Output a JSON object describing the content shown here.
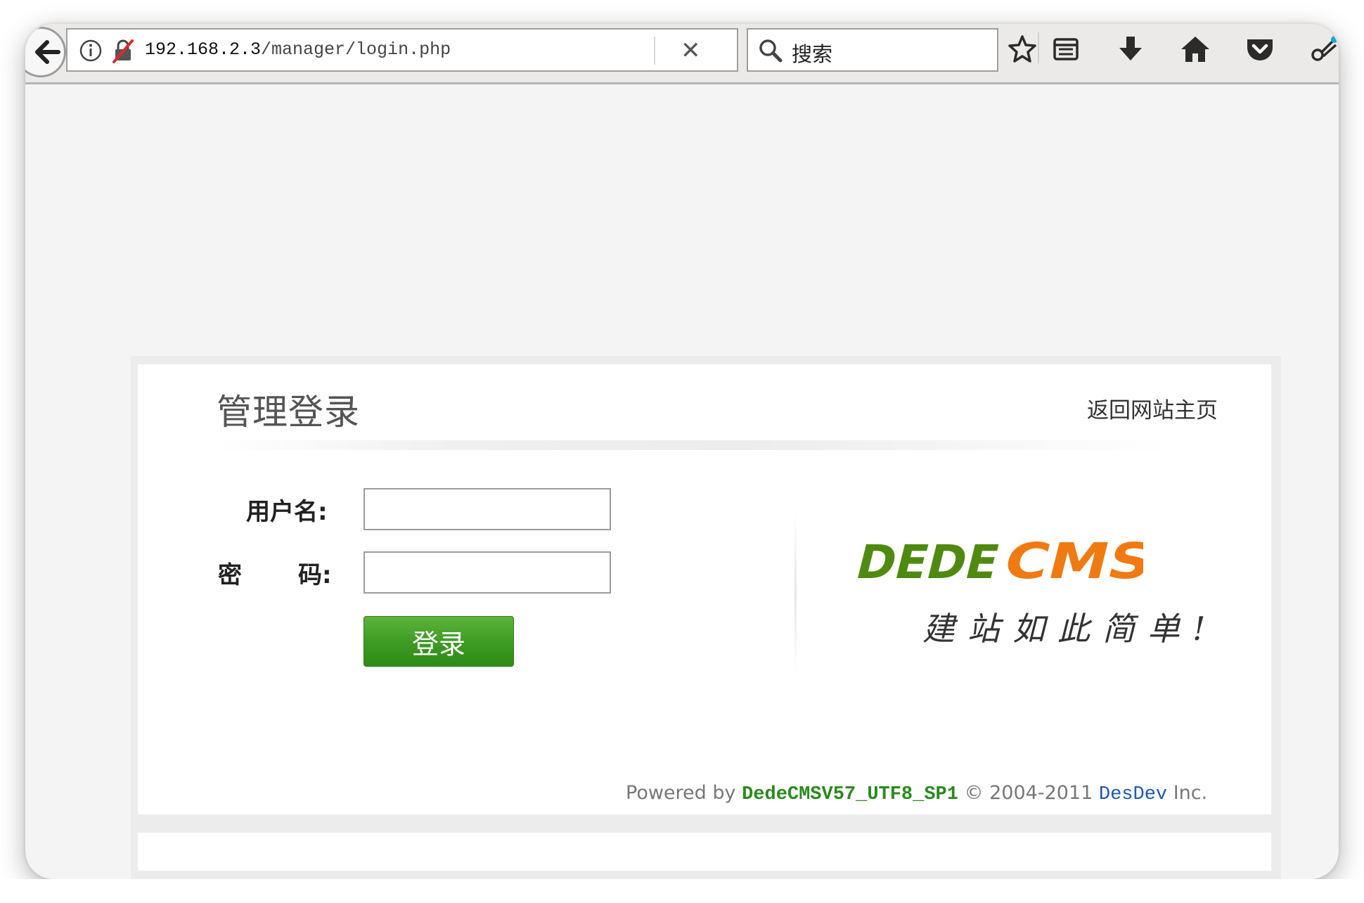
{
  "browser": {
    "url_host": "192.168.2.3",
    "url_path": "/manager/login.php",
    "search_placeholder": "搜索",
    "icons": [
      "back-arrow-icon",
      "info-icon",
      "insecure-lock-icon",
      "clear-url-icon",
      "search-icon",
      "bookmark-star-icon",
      "reading-list-icon",
      "download-icon",
      "home-icon",
      "pocket-icon",
      "extension-icon"
    ]
  },
  "login": {
    "title": "管理登录",
    "home_link": "返回网站主页",
    "username_label": "用户名:",
    "password_label_a": "密",
    "password_label_b": "码:",
    "username_value": "",
    "password_value": "",
    "submit_label": "登录"
  },
  "logo": {
    "text": "DEDECMS",
    "slogan": "建站如此简单!",
    "colors": {
      "dede": "#4f8a10",
      "cms": "#f07a12"
    }
  },
  "footer": {
    "prefix": "Powered by",
    "brand": "DedeCMSV57_UTF8_SP1",
    "copyright": "© 2004-2011",
    "company": "DesDev",
    "suffix": "Inc."
  }
}
